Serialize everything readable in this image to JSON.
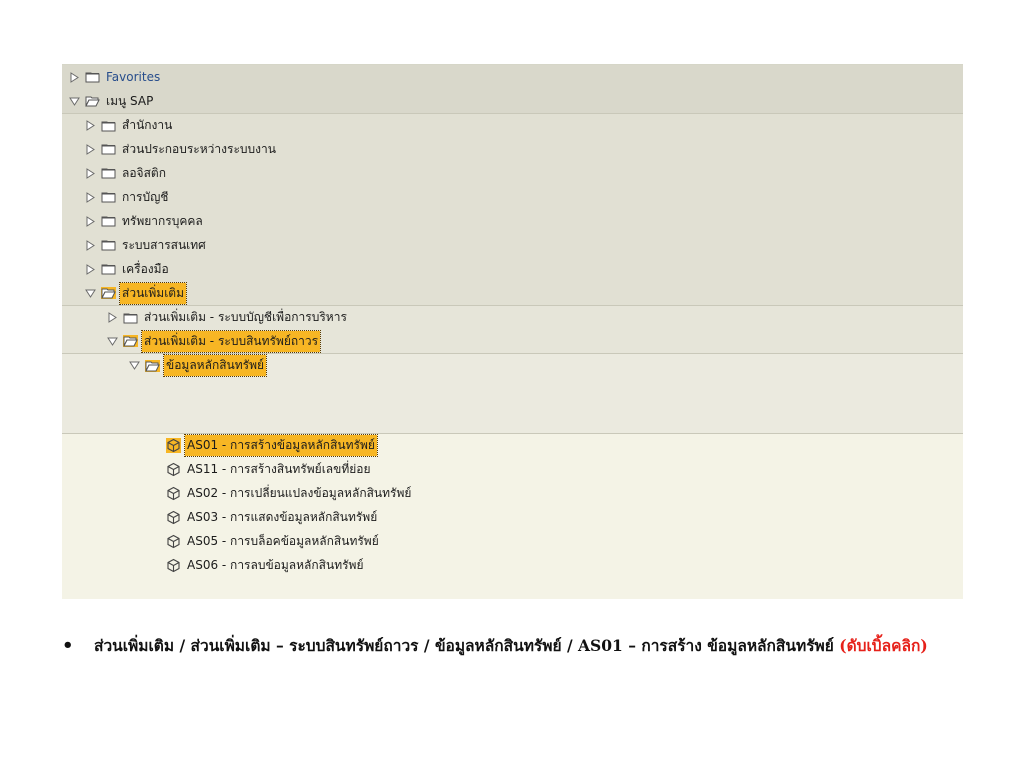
{
  "tree": {
    "favorites": "Favorites",
    "sap_menu": "เมนู SAP",
    "level1": [
      "สำนักงาน",
      "ส่วนประกอบระหว่างระบบงาน",
      "ลอจิสติก",
      "การบัญชี",
      "ทรัพยากรบุคคล",
      "ระบบสารสนเทศ",
      "เครื่องมือ"
    ],
    "addons": "ส่วนเพิ่มเติม",
    "addons_children": {
      "management_accounting": "ส่วนเพิ่มเติม - ระบบบัญชีเพื่อการบริหาร",
      "asset_system": "ส่วนเพิ่มเติม - ระบบสินทรัพย์ถาวร",
      "asset_master": "ข้อมูลหลักสินทรัพย์"
    },
    "transactions": [
      "AS01 - การสร้างข้อมูลหลักสินทรัพย์",
      "AS11 - การสร้างสินทรัพย์เลขที่ย่อย",
      "AS02 - การเปลี่ยนแปลงข้อมูลหลักสินทรัพย์",
      "AS03 - การแสดงข้อมูลหลักสินทรัพย์",
      "AS05 - การบล็อคข้อมูลหลักสินทรัพย์",
      "AS06 - การลบข้อมูลหลักสินทรัพย์"
    ]
  },
  "caption": {
    "bullet": "•",
    "text": "ส่วนเพิ่มเติม / ส่วนเพิ่มเติม – ระบบสินทรัพย์ถาวร / ข้อมูลหลักสินทรัพย์ / AS01 – การสร้าง ข้อมูลหลักสินทรัพย์ ",
    "hint": "(ดับเบิ้ลคลิก)"
  },
  "colors": {
    "selection": "#f7b624",
    "hint": "#e6211a",
    "link": "#274d8c"
  }
}
